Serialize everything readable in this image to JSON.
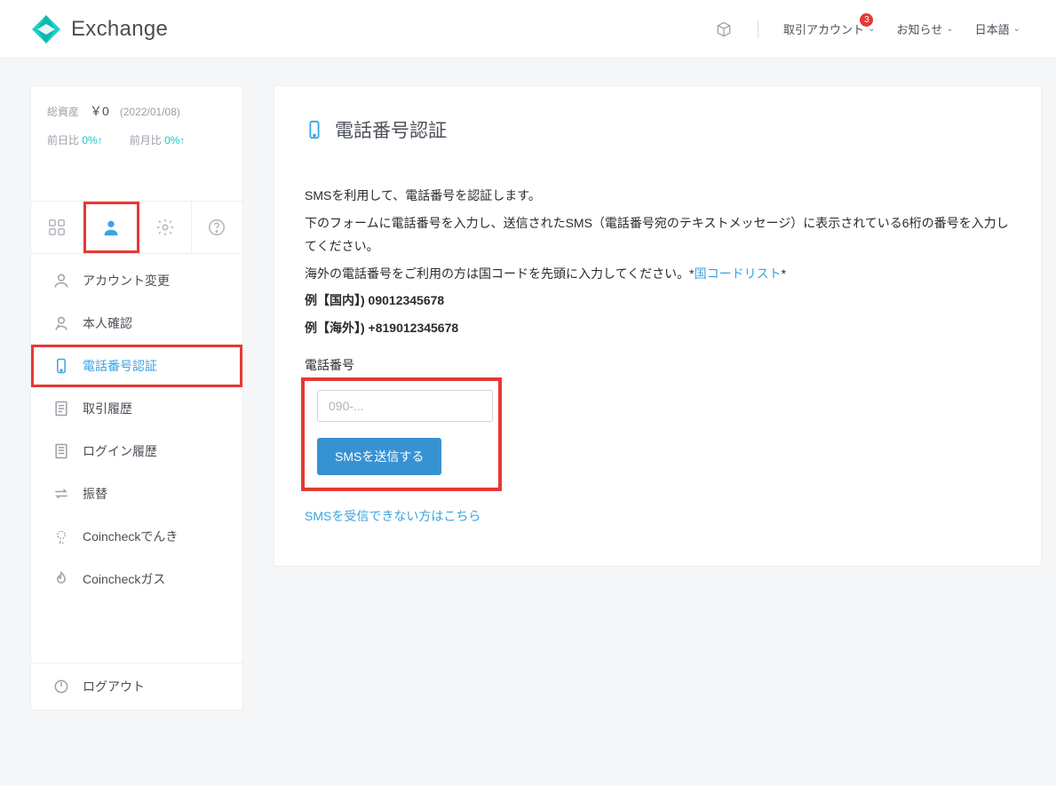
{
  "header": {
    "brand": "Exchange",
    "menu_account": "取引アカウント",
    "menu_notice": "お知らせ",
    "menu_lang": "日本語",
    "badge_count": "3"
  },
  "sidebar": {
    "balance_label": "総資産",
    "balance_value": "￥0",
    "balance_date": "(2022/01/08)",
    "dod_label": "前日比",
    "dod_value": "0%↑",
    "mom_label": "前月比",
    "mom_value": "0%↑",
    "items": {
      "account_change": "アカウント変更",
      "identity": "本人確認",
      "phone_auth": "電話番号認証",
      "trade_history": "取引履歴",
      "login_history": "ログイン履歴",
      "transfer": "振替",
      "cc_denki": "Coincheckでんき",
      "cc_gas": "Coincheckガス"
    },
    "logout": "ログアウト"
  },
  "main": {
    "title": "電話番号認証",
    "desc1": "SMSを利用して、電話番号を認証します。",
    "desc2": "下のフォームに電話番号を入力し、送信されたSMS（電話番号宛のテキストメッセージ）に表示されている6桁の番号を入力してください。",
    "desc3a": "海外の電話番号をご利用の方は国コードを先頭に入力してください。*",
    "country_link": "国コードリスト",
    "desc3b": "*",
    "example_domestic": "例【国内】) 09012345678",
    "example_overseas": "例【海外】) +819012345678",
    "phone_label": "電話番号",
    "phone_placeholder": "090-...",
    "send_button": "SMSを送信する",
    "help_link": "SMSを受信できない方はこちら"
  }
}
